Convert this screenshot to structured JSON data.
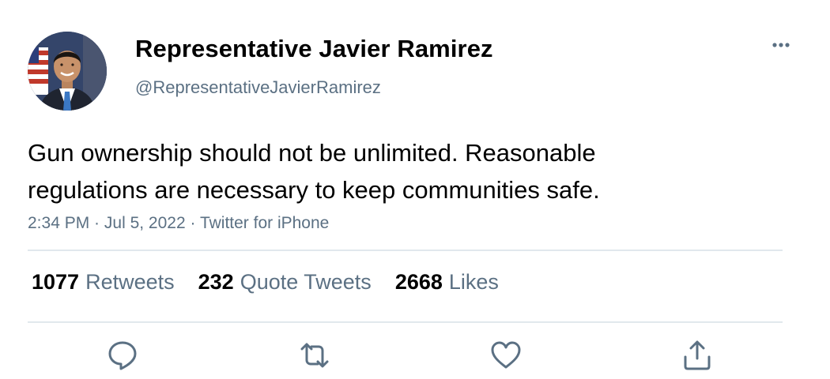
{
  "author": {
    "display_name": "Representative Javier Ramirez",
    "handle": "@RepresentativeJavierRamirez",
    "avatar_icon": "profile-photo"
  },
  "tweet": {
    "text_lines": [
      "Gun ownership should not be unlimited. Reasonable",
      "regulations are necessary to keep communities safe."
    ]
  },
  "meta": {
    "time": "2:34 PM",
    "separator": " · ",
    "date": "Jul 5, 2022",
    "source": "Twitter for iPhone"
  },
  "stats": [
    {
      "count": "1077",
      "label": "Retweets"
    },
    {
      "count": "232",
      "label": "Quote Tweets"
    },
    {
      "count": "2668",
      "label": "Likes"
    }
  ],
  "actions": [
    {
      "icon": "reply-icon"
    },
    {
      "icon": "retweet-icon"
    },
    {
      "icon": "like-icon"
    },
    {
      "icon": "share-icon"
    }
  ],
  "colors": {
    "secondary_text": "#5b7083",
    "divider": "#e1e8ed",
    "icon": "#5b7083"
  }
}
